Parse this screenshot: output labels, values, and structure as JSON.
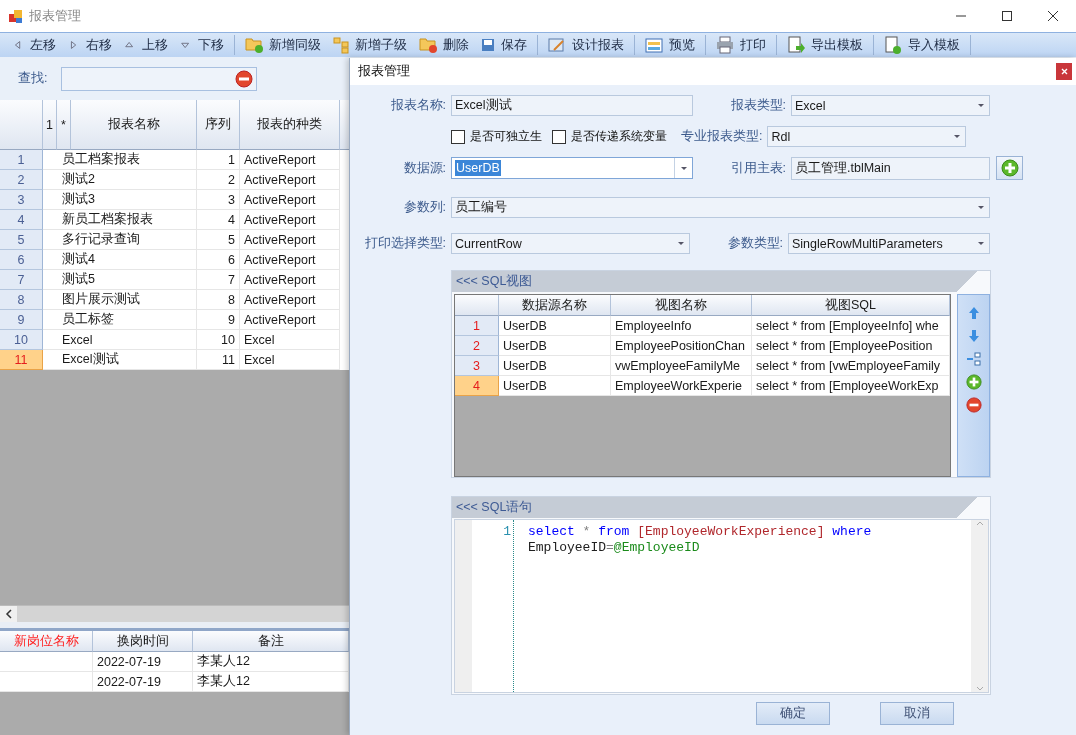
{
  "window": {
    "title": "报表管理"
  },
  "toolbar_groups": [
    [
      {
        "label": "左移",
        "kind": "left"
      },
      {
        "label": "右移",
        "kind": "right"
      },
      {
        "label": "上移",
        "kind": "up"
      },
      {
        "label": "下移",
        "kind": "down"
      }
    ],
    [
      {
        "label": "新增同级",
        "kind": "folder-add"
      },
      {
        "label": "新增子级",
        "kind": "tree"
      },
      {
        "label": "删除",
        "kind": "folder-remove"
      },
      {
        "label": "保存",
        "kind": "save"
      }
    ],
    [
      {
        "label": "设计报表",
        "kind": "design"
      }
    ],
    [
      {
        "label": "预览",
        "kind": "preview"
      }
    ],
    [
      {
        "label": "打印",
        "kind": "print"
      }
    ],
    [
      {
        "label": "导出模板",
        "kind": "export"
      }
    ],
    [
      {
        "label": "导入模板",
        "kind": "import"
      }
    ]
  ],
  "search": {
    "label": "查找:"
  },
  "report_grid": {
    "columns": [
      "1",
      "*",
      "报表名称",
      "序列",
      "报表的种类"
    ],
    "rows": [
      {
        "number": "1",
        "name": "员工档案报表",
        "order": "1",
        "type": "ActiveReport",
        "selected": false
      },
      {
        "number": "2",
        "name": "测试2",
        "order": "2",
        "type": "ActiveReport",
        "selected": false
      },
      {
        "number": "3",
        "name": "测试3",
        "order": "3",
        "type": "ActiveReport",
        "selected": false
      },
      {
        "number": "4",
        "name": "新员工档案报表",
        "order": "4",
        "type": "ActiveReport",
        "selected": false
      },
      {
        "number": "5",
        "name": "多行记录查询",
        "order": "5",
        "type": "ActiveReport",
        "selected": false
      },
      {
        "number": "6",
        "name": "测试4",
        "order": "6",
        "type": "ActiveReport",
        "selected": false
      },
      {
        "number": "7",
        "name": "测试5",
        "order": "7",
        "type": "ActiveReport",
        "selected": false
      },
      {
        "number": "8",
        "name": "图片展示测试",
        "order": "8",
        "type": "ActiveReport",
        "selected": false
      },
      {
        "number": "9",
        "name": "员工标签",
        "order": "9",
        "type": "ActiveReport",
        "selected": false
      },
      {
        "number": "10",
        "name": "Excel",
        "order": "10",
        "type": "Excel",
        "selected": false
      },
      {
        "number": "11",
        "name": "Excel测试",
        "order": "11",
        "type": "Excel",
        "selected": true
      }
    ]
  },
  "change_grid": {
    "columns": [
      {
        "label": "新岗位名称",
        "required": true
      },
      {
        "label": "换岗时间",
        "required": false
      },
      {
        "label": "备注",
        "required": false
      }
    ],
    "rows": [
      {
        "date": "2022-07-19",
        "note": "李某人12"
      },
      {
        "date": "2022-07-19",
        "note": "李某人12"
      }
    ]
  },
  "dialog": {
    "title": "报表管理",
    "report_name": {
      "label": "报表名称:",
      "value": "Excel测试"
    },
    "report_type": {
      "label": "报表类型:",
      "value": "Excel"
    },
    "checkboxes": [
      {
        "label": "是否可独立生",
        "checked": false
      },
      {
        "label": "是否传递系统变量",
        "checked": false
      }
    ],
    "pro_type": {
      "label": "专业报表类型:",
      "value": "Rdl"
    },
    "data_source": {
      "label": "数据源:",
      "value": "UserDB",
      "text_selected": true
    },
    "main_table": {
      "label": "引用主表:",
      "value": "员工管理.tblMain"
    },
    "param_column": {
      "label": "参数列:",
      "value": "员工编号"
    },
    "print_type": {
      "label": "打印选择类型:",
      "value": "CurrentRow"
    },
    "param_type": {
      "label": "参数类型:",
      "value": "SingleRowMultiParameters"
    },
    "sql_view": {
      "title": "<<< SQL视图",
      "columns": [
        "数据源名称",
        "视图名称",
        "视图SQL"
      ],
      "rows": [
        {
          "number": "1",
          "source": "UserDB",
          "view": "EmployeeInfo",
          "sql": "select * from [EmployeeInfo] whe",
          "selected": false
        },
        {
          "number": "2",
          "source": "UserDB",
          "view": "EmployeePositionChan",
          "sql": "select * from [EmployeePosition",
          "selected": false
        },
        {
          "number": "3",
          "source": "UserDB",
          "view": "vwEmployeeFamilyMe",
          "sql": "select * from [vwEmployeeFamily",
          "selected": false
        },
        {
          "number": "4",
          "source": "UserDB",
          "view": "EmployeeWorkExperie",
          "sql": "select * from [EmployeeWorkExp",
          "selected": true
        }
      ]
    },
    "sql_text": {
      "title": "<<< SQL语句",
      "line_number": "1",
      "tokens": [
        {
          "kind": "keyword",
          "text": "select"
        },
        {
          "kind": "operator",
          "text": " * "
        },
        {
          "kind": "keyword",
          "text": "from"
        },
        {
          "kind": "bracket",
          "text": " [EmployeeWorkExperience] "
        },
        {
          "kind": "keyword",
          "text": "where"
        },
        {
          "kind": "plain",
          "text": " EmployeeID"
        },
        {
          "kind": "operator",
          "text": "="
        },
        {
          "kind": "param",
          "text": "@EmployeeID"
        }
      ]
    },
    "buttons": [
      "确定",
      "取消"
    ]
  }
}
